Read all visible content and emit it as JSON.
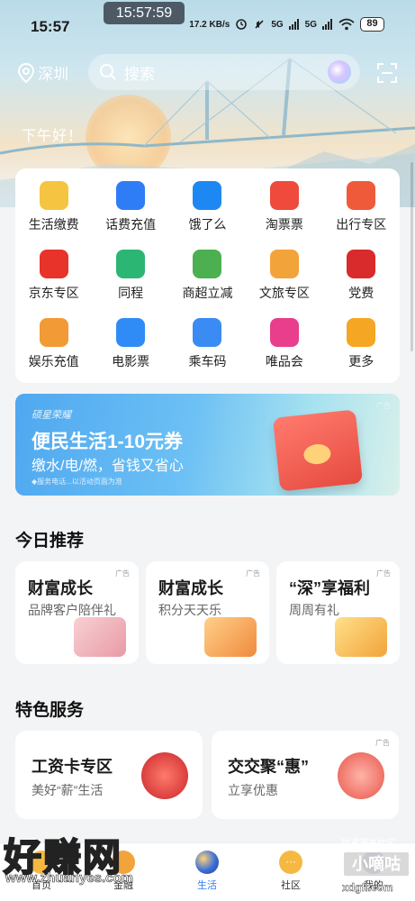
{
  "status_bar": {
    "time": "15:57",
    "clock_overlay": "15:57:59",
    "net_speed": "17.2 KB/s",
    "signal1": "5G",
    "signal2": "5G",
    "battery": "89"
  },
  "top_bar": {
    "location": "深圳",
    "search_placeholder": "搜索"
  },
  "greeting": "下午好！",
  "services": [
    {
      "label": "生活缴费",
      "icon": "utility-bill-icon",
      "color": "#f5c542"
    },
    {
      "label": "话费充值",
      "icon": "phone-topup-icon",
      "color": "#2f7df6"
    },
    {
      "label": "饿了么",
      "icon": "eleme-icon",
      "color": "#1e88f2"
    },
    {
      "label": "淘票票",
      "icon": "taopiaopiao-icon",
      "color": "#ef4a3c"
    },
    {
      "label": "出行专区",
      "icon": "travel-map-icon",
      "color": "#ef5a3a"
    },
    {
      "label": "京东专区",
      "icon": "jd-icon",
      "color": "#e8332b"
    },
    {
      "label": "同程",
      "icon": "tongcheng-icon",
      "color": "#2bb673"
    },
    {
      "label": "商超立减",
      "icon": "supermarket-basket-icon",
      "color": "#4cb050"
    },
    {
      "label": "文旅专区",
      "icon": "culture-travel-icon",
      "color": "#f2a33a"
    },
    {
      "label": "党费",
      "icon": "party-emblem-icon",
      "color": "#d92b2b"
    },
    {
      "label": "娱乐充值",
      "icon": "entertainment-topup-icon",
      "color": "#f29a35"
    },
    {
      "label": "电影票",
      "icon": "movie-clapper-icon",
      "color": "#2f8cf6"
    },
    {
      "label": "乘车码",
      "icon": "ride-qr-icon",
      "color": "#3a8bf3"
    },
    {
      "label": "唯品会",
      "icon": "vip-shop-icon",
      "color": "#e83e8c"
    },
    {
      "label": "更多",
      "icon": "more-grid-icon",
      "color": "#f5a623"
    }
  ],
  "banner": {
    "brand": "硕星荣耀",
    "title": "便民生活1-10元券",
    "subtitle": "缴水/电/燃，省钱又省心",
    "tiny": "◆服务电话...以活动页面为准",
    "ad": "广告"
  },
  "today": {
    "title": "今日推荐",
    "cards": [
      {
        "title": "财富成长",
        "subtitle": "品牌客户陪伴礼",
        "ad": "广告",
        "icon": "wallet-gift-icon",
        "color": "#f3b3b8"
      },
      {
        "title": "财富成长",
        "subtitle": "积分天天乐",
        "ad": "广告",
        "icon": "folder-coins-icon",
        "color": "#f6a34a"
      },
      {
        "title": "“深”享福利",
        "subtitle": "周周有礼",
        "ad": "广告",
        "icon": "gift-box-icon",
        "color": "#f7b84b"
      }
    ]
  },
  "featured": {
    "title": "特色服务",
    "cards": [
      {
        "title": "工资卡专区",
        "subtitle": "美好“薪”生活",
        "icon": "salary-card-gift-icon",
        "color": "#e23b3b"
      },
      {
        "title": "交交聚“惠”",
        "subtitle": "立享优惠",
        "ad": "广告",
        "icon": "stage-gift-icon",
        "color": "#ef6b5a"
      }
    ]
  },
  "tabbar": [
    {
      "label": "首页",
      "icon": "home-icon",
      "active": false
    },
    {
      "label": "金融",
      "icon": "finance-icon",
      "active": false
    },
    {
      "label": "生活",
      "icon": "life-icon",
      "active": true
    },
    {
      "label": "社区",
      "icon": "community-icon",
      "active": false
    },
    {
      "label": "我的",
      "icon": "profile-icon",
      "active": false
    }
  ],
  "watermark": {
    "left_text": "好赚网",
    "left_url": "www.zhuanyes.com",
    "right_top": "找资源关社区",
    "right_text": "小嘀咕",
    "right_url": "xdgfl.com"
  }
}
